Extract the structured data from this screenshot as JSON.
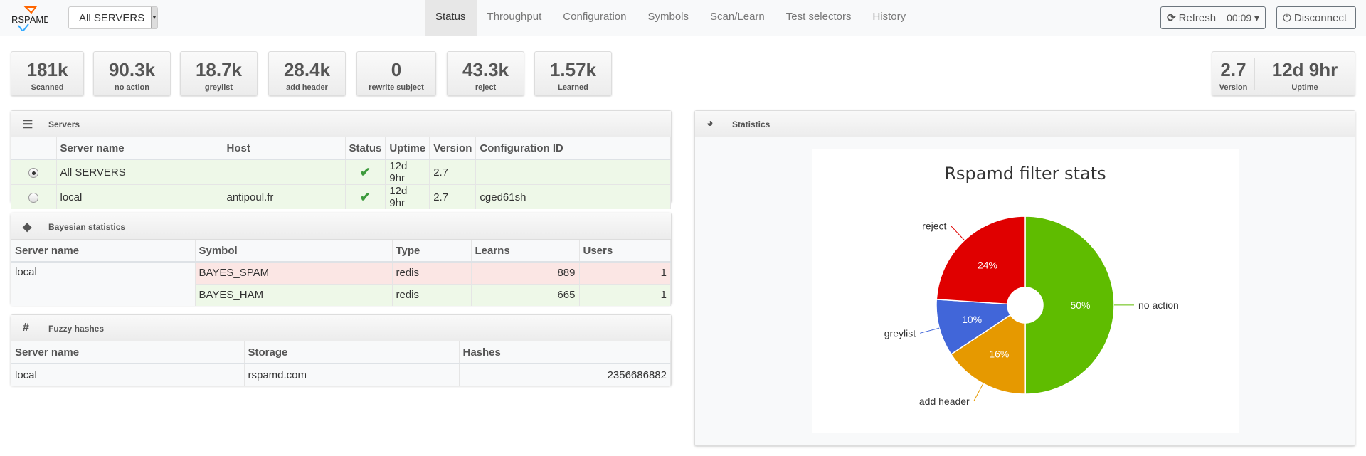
{
  "nav": {
    "logo": "RSPAMD",
    "server_select": "All SERVERS",
    "tabs": [
      "Status",
      "Throughput",
      "Configuration",
      "Symbols",
      "Scan/Learn",
      "Test selectors",
      "History"
    ],
    "active_tab": "Status",
    "refresh_label": "Refresh",
    "refresh_interval": "00:09",
    "disconnect_label": "Disconnect"
  },
  "stats": [
    {
      "value": "181k",
      "label": "Scanned"
    },
    {
      "value": "90.3k",
      "label": "no action"
    },
    {
      "value": "18.7k",
      "label": "greylist"
    },
    {
      "value": "28.4k",
      "label": "add header"
    },
    {
      "value": "0",
      "label": "rewrite subject"
    },
    {
      "value": "43.3k",
      "label": "reject"
    },
    {
      "value": "1.57k",
      "label": "Learned"
    }
  ],
  "info": {
    "version": "2.7",
    "version_label": "Version",
    "uptime": "12d 9hr",
    "uptime_label": "Uptime"
  },
  "servers": {
    "title": "Servers",
    "columns": [
      "",
      "Server name",
      "Host",
      "Status",
      "Uptime",
      "Version",
      "Configuration ID"
    ],
    "rows": [
      {
        "selected": true,
        "name": "All SERVERS",
        "host": "",
        "status": "ok",
        "uptime": "12d 9hr",
        "version": "2.7",
        "config_id": ""
      },
      {
        "selected": false,
        "name": "local",
        "host": "antipoul.fr",
        "status": "ok",
        "uptime": "12d 9hr",
        "version": "2.7",
        "config_id": "cged61sh"
      }
    ]
  },
  "bayes": {
    "title": "Bayesian statistics",
    "columns": [
      "Server name",
      "Symbol",
      "Type",
      "Learns",
      "Users"
    ],
    "server": "local",
    "rows": [
      {
        "symbol": "BAYES_SPAM",
        "type": "redis",
        "learns": "889",
        "users": "1"
      },
      {
        "symbol": "BAYES_HAM",
        "type": "redis",
        "learns": "665",
        "users": "1"
      }
    ]
  },
  "fuzzy": {
    "title": "Fuzzy hashes",
    "columns": [
      "Server name",
      "Storage",
      "Hashes"
    ],
    "rows": [
      {
        "server": "local",
        "storage": "rspamd.com",
        "hashes": "2356686882"
      }
    ]
  },
  "statistics": {
    "title": "Statistics"
  },
  "chart_data": {
    "type": "pie",
    "title": "Rspamd filter stats",
    "donut": true,
    "slices": [
      {
        "label": "no action",
        "value": 90.3,
        "percent": "50%",
        "color": "#5fbc00"
      },
      {
        "label": "add header",
        "value": 28.4,
        "percent": "16%",
        "color": "#e69900"
      },
      {
        "label": "greylist",
        "value": 18.7,
        "percent": "10%",
        "color": "#4166d9"
      },
      {
        "label": "reject",
        "value": 43.3,
        "percent": "24%",
        "color": "#e00000"
      }
    ]
  }
}
